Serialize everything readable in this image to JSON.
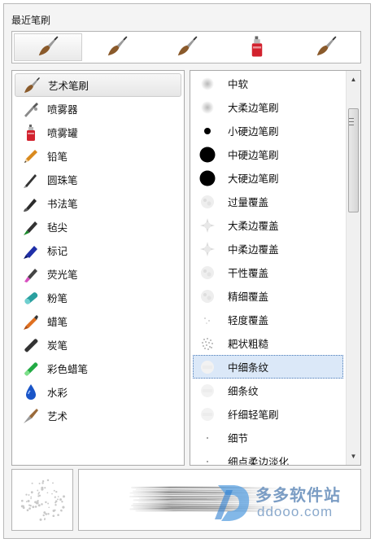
{
  "recent": {
    "label": "最近笔刷",
    "slots": [
      {
        "icon": "art-brush-icon",
        "selected": true
      },
      {
        "icon": "art-brush-icon",
        "selected": false
      },
      {
        "icon": "art-brush-icon",
        "selected": false
      },
      {
        "icon": "spray-can-icon",
        "selected": false
      },
      {
        "icon": "art-brush-icon",
        "selected": false
      }
    ]
  },
  "tools": [
    {
      "label": "艺术笔刷",
      "icon": "art-brush-icon",
      "color": "#8a5a2b",
      "selected": true
    },
    {
      "label": "喷雾器",
      "icon": "airbrush-icon",
      "color": "#7a7a7a"
    },
    {
      "label": "喷雾罐",
      "icon": "spray-can-icon",
      "color": "#d2222e"
    },
    {
      "label": "铅笔",
      "icon": "pencil-icon",
      "color": "#d98a1e"
    },
    {
      "label": "圆珠笔",
      "icon": "ballpoint-pen-icon",
      "color": "#333333"
    },
    {
      "label": "书法笔",
      "icon": "calligraphy-pen-icon",
      "color": "#2b2b2b"
    },
    {
      "label": "毡尖",
      "icon": "felt-tip-icon",
      "color": "#1b8a2a"
    },
    {
      "label": "标记",
      "icon": "marker-icon",
      "color": "#1f2fa8"
    },
    {
      "label": "荧光笔",
      "icon": "highlighter-icon",
      "color": "#d84fc0"
    },
    {
      "label": "粉笔",
      "icon": "chalk-icon",
      "color": "#2aa0a0"
    },
    {
      "label": "蜡笔",
      "icon": "crayon-icon",
      "color": "#e07020"
    },
    {
      "label": "炭笔",
      "icon": "charcoal-icon",
      "color": "#333333"
    },
    {
      "label": "彩色蜡笔",
      "icon": "color-crayon-icon",
      "color": "#22aa44"
    },
    {
      "label": "水彩",
      "icon": "watercolor-drop-icon",
      "color": "#1a55c8"
    },
    {
      "label": "艺术",
      "icon": "art-knife-icon",
      "color": "#9a6a3a"
    }
  ],
  "brushes": [
    {
      "label": "中软",
      "icon": "soft-dot-icon"
    },
    {
      "label": "大柔边笔刷",
      "icon": "soft-dot-icon"
    },
    {
      "label": "小硬边笔刷",
      "icon": "small-hard-dot-icon"
    },
    {
      "label": "中硬边笔刷",
      "icon": "hard-dot-icon"
    },
    {
      "label": "大硬边笔刷",
      "icon": "hard-dot-icon"
    },
    {
      "label": "过量覆盖",
      "icon": "texture-dot-icon"
    },
    {
      "label": "大柔边覆盖",
      "icon": "star-texture-icon"
    },
    {
      "label": "中柔边覆盖",
      "icon": "star-texture-icon"
    },
    {
      "label": "干性覆盖",
      "icon": "texture-dot-icon"
    },
    {
      "label": "精细覆盖",
      "icon": "texture-dot-icon"
    },
    {
      "label": "轻度覆盖",
      "icon": "light-dots-icon"
    },
    {
      "label": "耙状粗糙",
      "icon": "speckle-icon"
    },
    {
      "label": "中细条纹",
      "icon": "faint-stripe-icon",
      "selected": true
    },
    {
      "label": "细条纹",
      "icon": "faint-stripe-icon"
    },
    {
      "label": "纤细轻笔刷",
      "icon": "faint-stripe-icon"
    },
    {
      "label": "细节",
      "icon": "tiny-dot-icon"
    },
    {
      "label": "细点柔边淡化",
      "icon": "tiny-dot-icon"
    }
  ],
  "watermark": {
    "cn": "多多软件站",
    "en": "ddooo.com"
  },
  "colors": {
    "selection_blue": "#dbe8f8",
    "watermark_blue": "#7b9dc4"
  }
}
